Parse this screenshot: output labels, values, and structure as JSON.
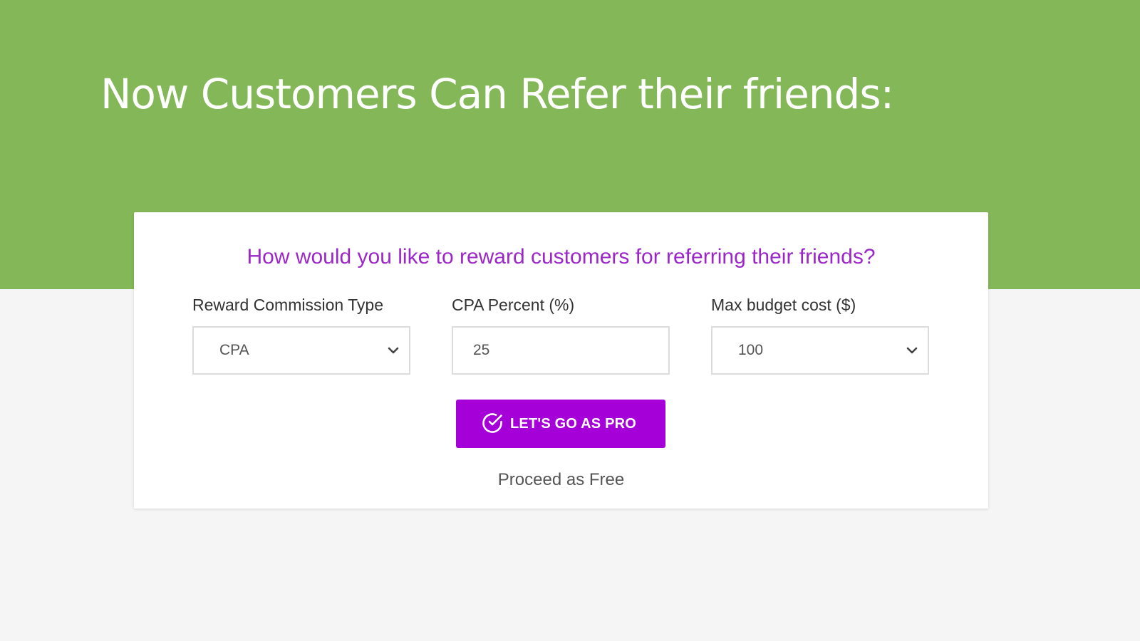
{
  "hero": {
    "title": "Now Customers Can Refer their friends:"
  },
  "card": {
    "question": "How would you like to reward customers for referring their friends?",
    "fields": [
      {
        "label": "Reward Commission Type",
        "type": "select",
        "value": "CPA"
      },
      {
        "label": "CPA Percent (%)",
        "type": "input",
        "value": "25"
      },
      {
        "label": "Max budget cost ($)",
        "type": "select",
        "value": "100"
      }
    ],
    "primary_button": {
      "label": "LET'S GO AS PRO",
      "icon": "check-circle-icon"
    },
    "secondary_link": "Proceed as Free"
  },
  "colors": {
    "hero_background": "#84b758",
    "accent": "#a600d9",
    "question_text": "#9c27c8",
    "page_background": "#f5f5f5"
  }
}
